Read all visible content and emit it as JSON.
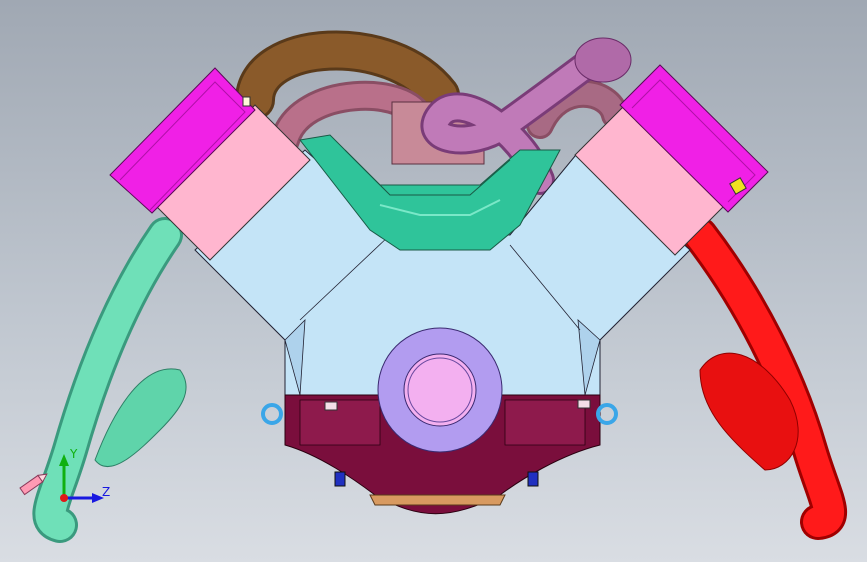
{
  "viewport": {
    "background_top": "#a0a8b3",
    "background_bottom": "#d9dde3"
  },
  "model": {
    "parts": [
      {
        "name": "engine-block",
        "color": "#c4e4f7"
      },
      {
        "name": "cylinder-head-left",
        "color": "#ffb6cf"
      },
      {
        "name": "cylinder-head-right",
        "color": "#ffb6cf"
      },
      {
        "name": "valve-cover-left",
        "color": "#f020e6"
      },
      {
        "name": "valve-cover-right",
        "color": "#f020e6"
      },
      {
        "name": "intake-manifold",
        "color": "#2fc49a"
      },
      {
        "name": "intake-runner-brown",
        "color": "#8a5a2a"
      },
      {
        "name": "intake-runner-mauve",
        "color": "#b9708a"
      },
      {
        "name": "intake-pipe-purple",
        "color": "#c07ab8"
      },
      {
        "name": "exhaust-pipe-left",
        "color": "#6fe0b8"
      },
      {
        "name": "exhaust-pipe-right",
        "color": "#ff1a1a"
      },
      {
        "name": "oil-pan",
        "color": "#7a0e3c"
      },
      {
        "name": "crankshaft-pulley",
        "color": "#b29cf0"
      },
      {
        "name": "lifting-eye",
        "color": "#3aa6e8"
      }
    ]
  },
  "triad": {
    "x_label": "Z",
    "y_label": "Y",
    "y_color": "#10b010",
    "z_color": "#1818e0",
    "x_color": "#e01818"
  }
}
